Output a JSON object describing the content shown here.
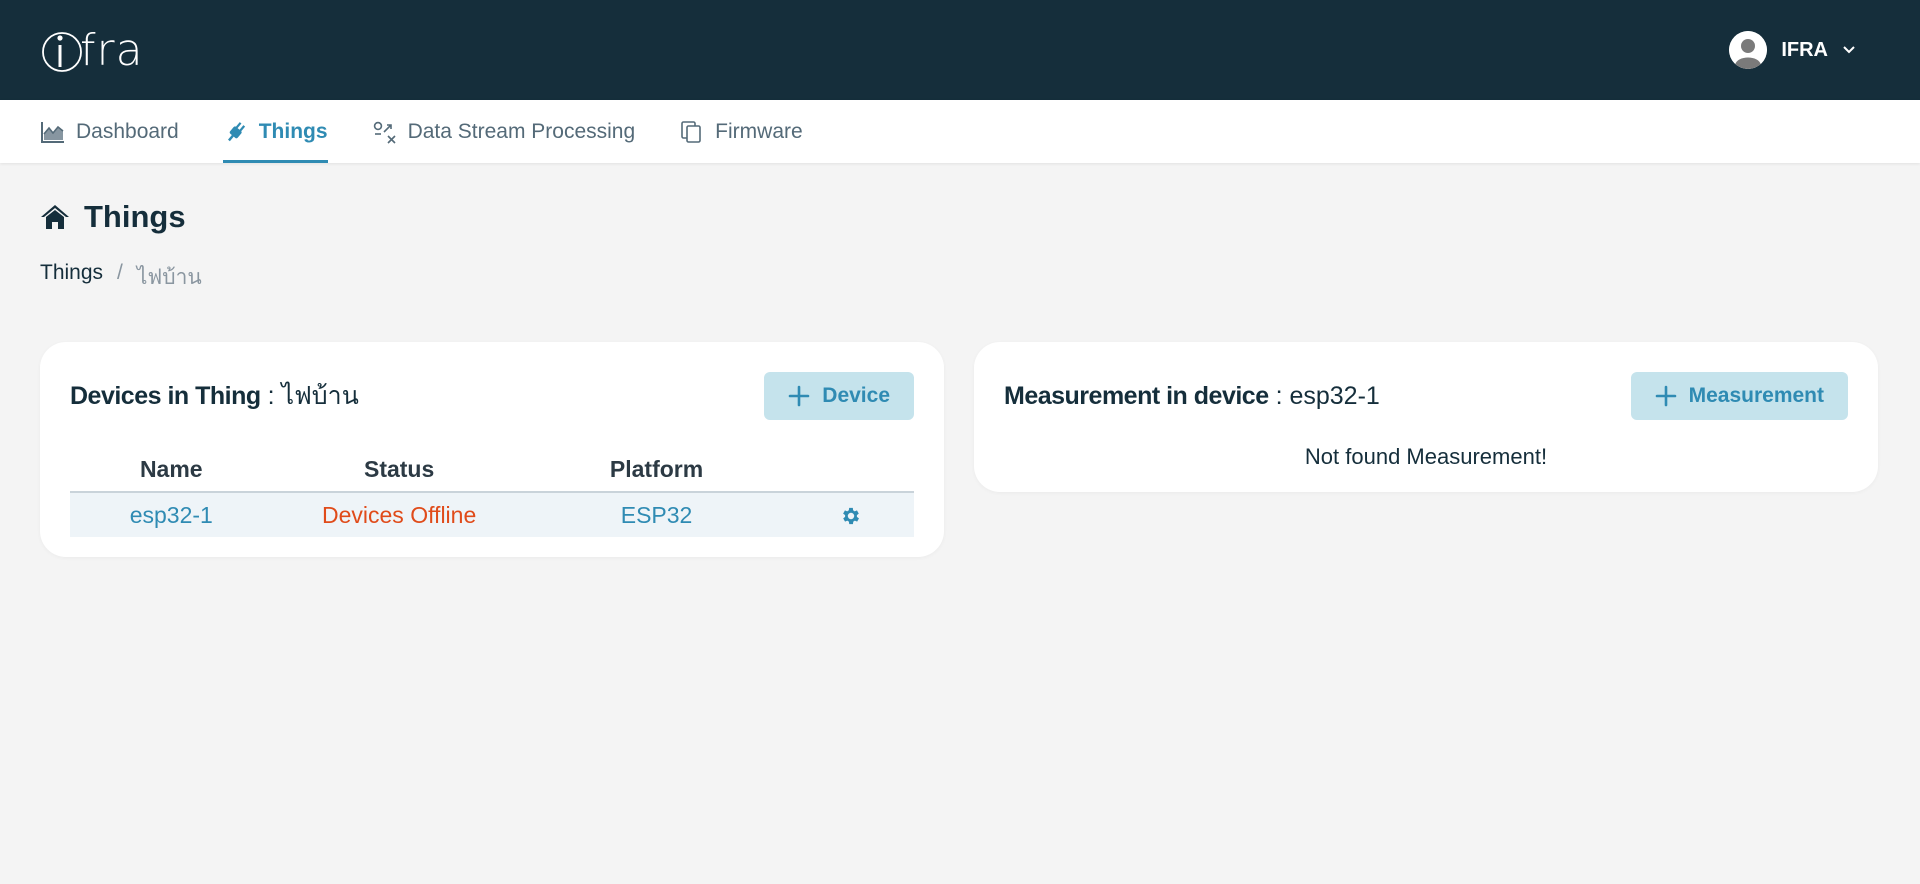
{
  "app": {
    "logo_text": "fra"
  },
  "user": {
    "name": "IFRA"
  },
  "nav": {
    "items": [
      {
        "label": "Dashboard",
        "icon": "chart-area-icon"
      },
      {
        "label": "Things",
        "icon": "plug-icon",
        "active": true
      },
      {
        "label": "Data Stream Processing",
        "icon": "shuffle-x-icon"
      },
      {
        "label": "Firmware",
        "icon": "copy-icon"
      }
    ]
  },
  "page": {
    "title": "Things",
    "breadcrumb": {
      "link": "Things",
      "separator": "/",
      "current": "ไฟบ้าน"
    }
  },
  "devices_card": {
    "title_prefix": "Devices in Thing",
    "title_sep": " : ",
    "thing_name": "ไฟบ้าน",
    "add_button": "Device",
    "columns": [
      "Name",
      "Status",
      "Platform"
    ],
    "rows": [
      {
        "name": "esp32-1",
        "status": "Devices Offline",
        "platform": "ESP32"
      }
    ]
  },
  "measurement_card": {
    "title_prefix": "Measurement in device",
    "title_sep": " : ",
    "device_name": "esp32-1",
    "add_button": "Measurement",
    "empty_message": "Not found Measurement!"
  },
  "colors": {
    "topbar": "#152e3b",
    "accent": "#2f8bb3",
    "offline": "#e04b1a",
    "button_bg": "#c5e3ec"
  }
}
